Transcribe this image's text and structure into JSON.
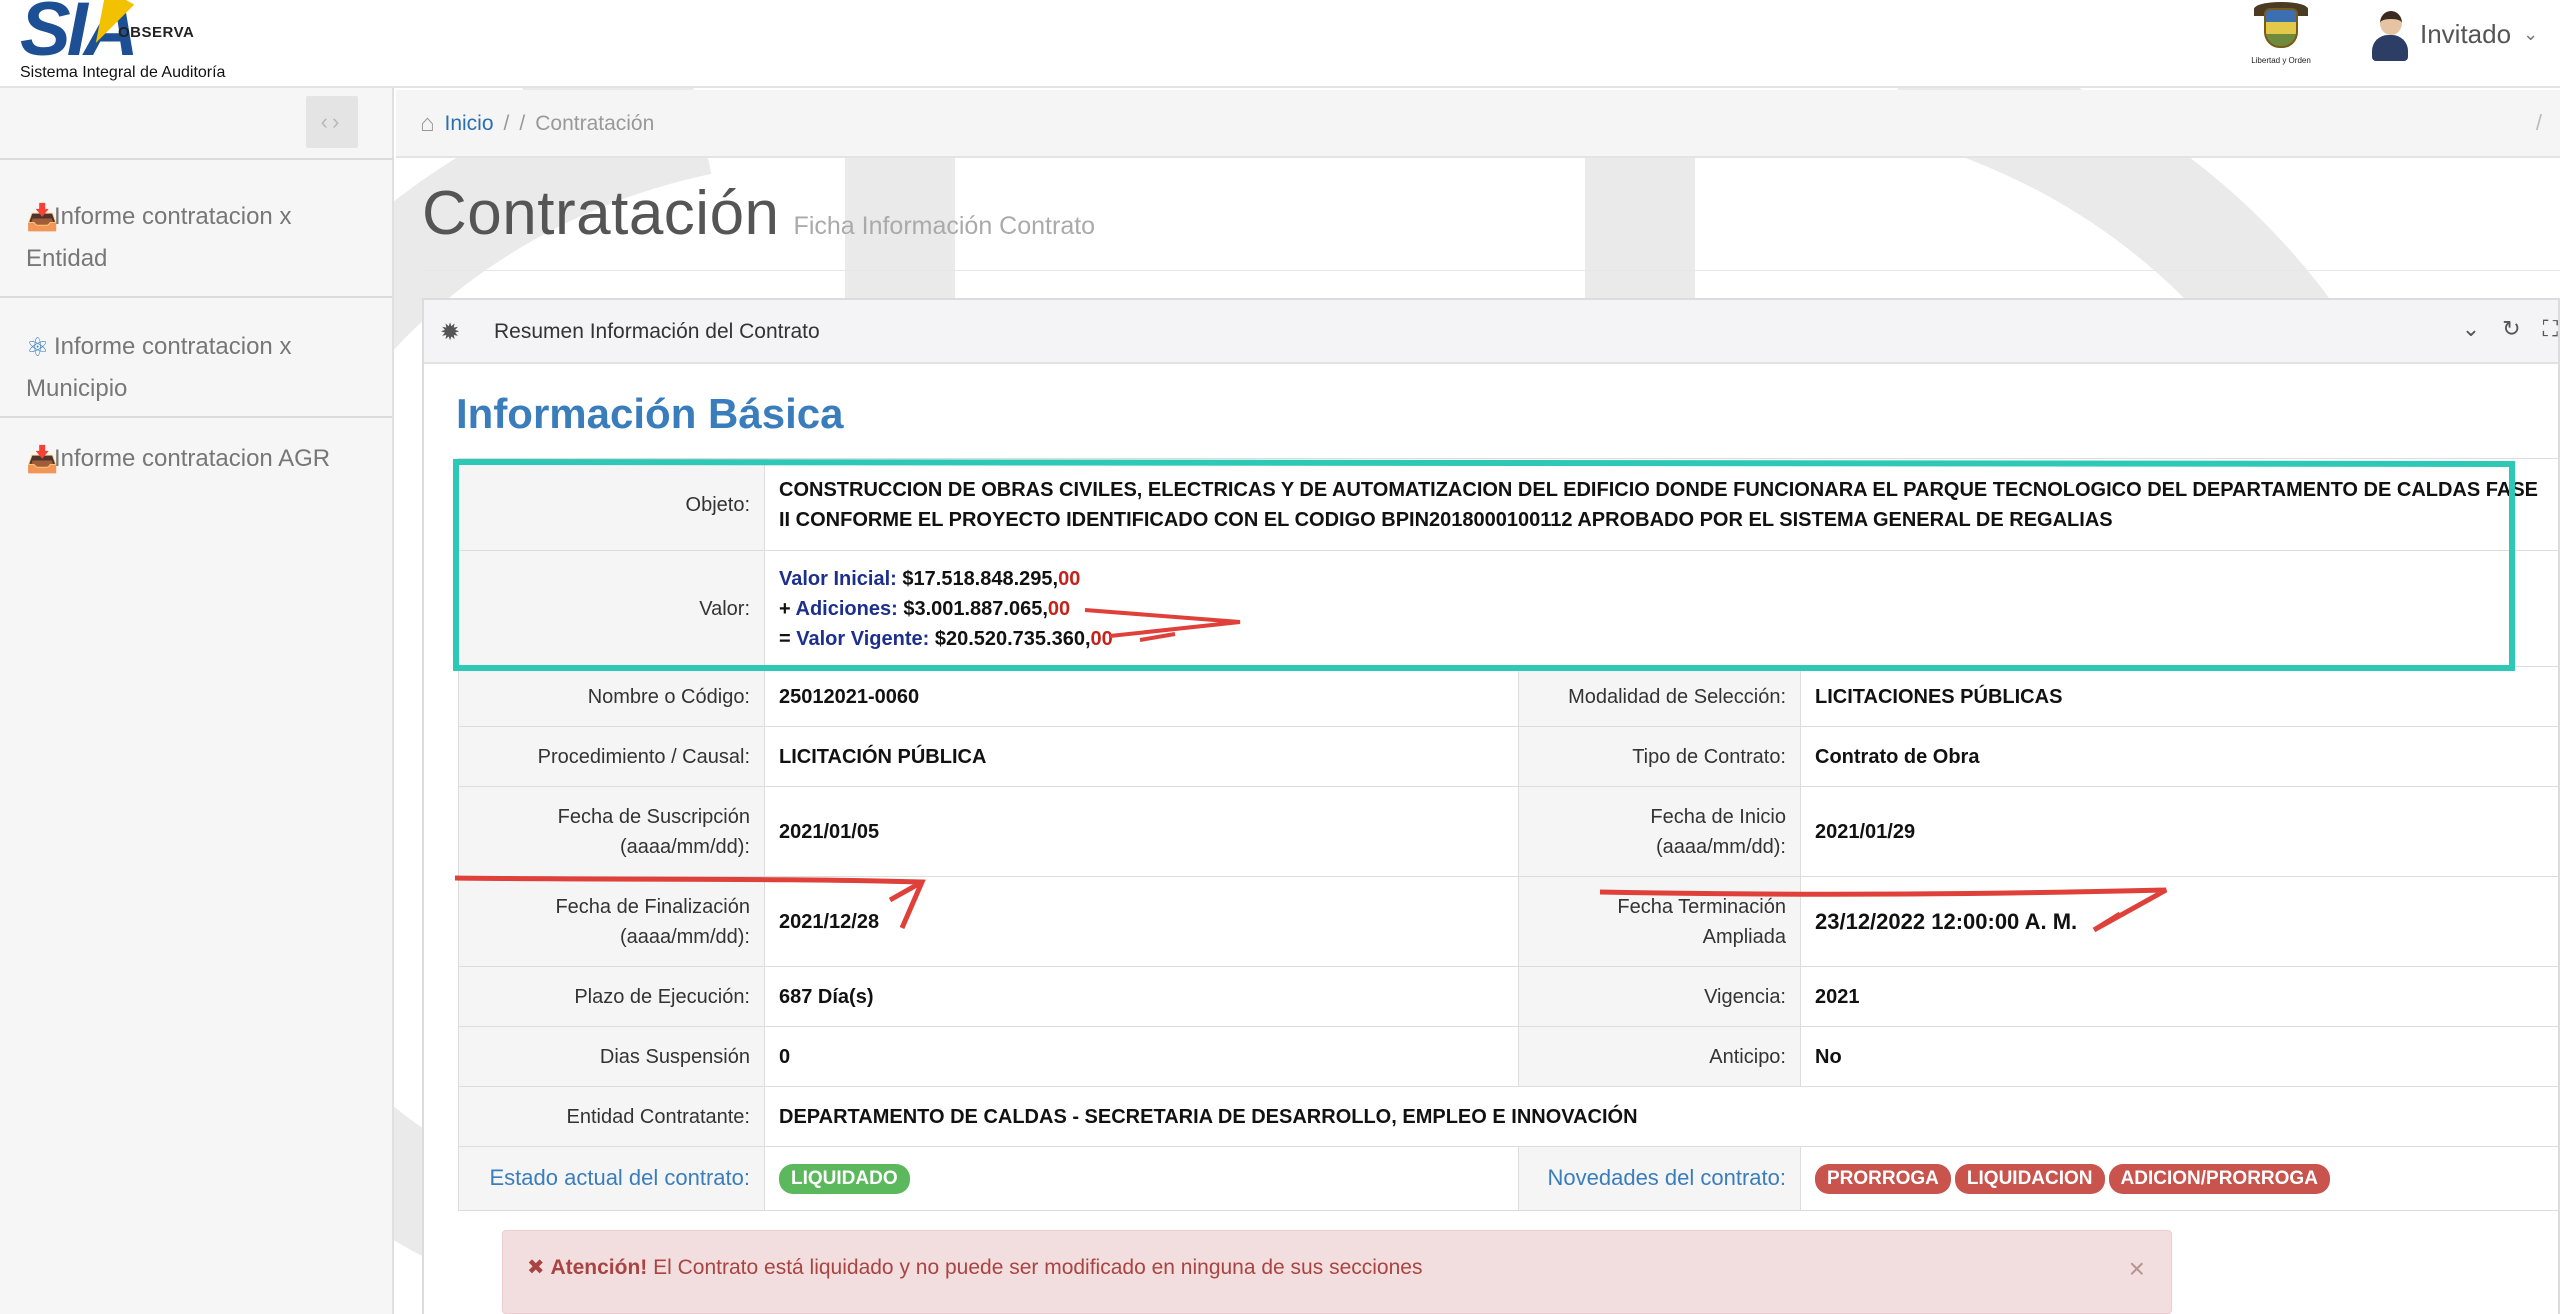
{
  "header": {
    "logo_text": "SIA",
    "logo_badge": "OBSERVA",
    "logo_subtitle": "Sistema Integral de Auditoría",
    "emblem_caption": "Libertad y Orden",
    "user_name": "Invitado"
  },
  "sidebar": {
    "items": [
      {
        "label": "Informe contratacion x Entidad",
        "icon": "inbox-icon"
      },
      {
        "label": "Informe contratacion x Municipio",
        "icon": "atom-icon"
      },
      {
        "label": "Informe contratacion AGR",
        "icon": "inbox-icon"
      }
    ]
  },
  "breadcrumb": {
    "home": "Inicio",
    "separator": "/",
    "current": "Contratación"
  },
  "page": {
    "title": "Contratación",
    "subtitle": "Ficha Información Contrato"
  },
  "panel": {
    "title": "Resumen Información del Contrato"
  },
  "section": {
    "title": "Información Básica"
  },
  "contract": {
    "objeto_label": "Objeto:",
    "objeto": "CONSTRUCCION DE OBRAS CIVILES, ELECTRICAS Y DE AUTOMATIZACION DEL EDIFICIO DONDE FUNCIONARA EL PARQUE TECNOLOGICO DEL DEPARTAMENTO DE CALDAS FASE II CONFORME EL PROYECTO IDENTIFICADO CON EL CODIGO BPIN2018000100112 APROBADO POR EL SISTEMA GENERAL DE REGALIAS",
    "valor_label": "Valor:",
    "valor_inicial_label": "Valor Inicial:",
    "valor_inicial": "$17.518.848.295,",
    "valor_inicial_cents": "00",
    "adiciones_prefix": "+",
    "adiciones_label": "Adiciones:",
    "adiciones": "$3.001.887.065,",
    "adiciones_cents": "00",
    "vigente_prefix": "=",
    "vigente_label": "Valor Vigente:",
    "vigente": "$20.520.735.360,",
    "vigente_cents": "00",
    "rows": [
      {
        "l1": "Nombre o Código:",
        "v1": "25012021-0060",
        "l2": "Modalidad de Selección:",
        "v2": "LICITACIONES PÚBLICAS"
      },
      {
        "l1": "Procedimiento / Causal:",
        "v1": "LICITACIÓN PÚBLICA",
        "l2": "Tipo de Contrato:",
        "v2": "Contrato de Obra"
      },
      {
        "l1": "Fecha de Suscripción (aaaa/mm/dd):",
        "v1": "2021/01/05",
        "l2": "Fecha de Inicio (aaaa/mm/dd):",
        "v2": "2021/01/29"
      },
      {
        "l1": "Fecha de Finalización (aaaa/mm/dd):",
        "v1": "2021/12/28",
        "l2": "Fecha Terminación Ampliada",
        "v2": "23/12/2022 12:00:00 A. M."
      },
      {
        "l1": "Plazo de Ejecución:",
        "v1": "687 Día(s)",
        "l2": "Vigencia:",
        "v2": "2021"
      },
      {
        "l1": "Dias Suspensión",
        "v1": "0",
        "l2": "Anticipo:",
        "v2": "No"
      }
    ],
    "entidad_label": "Entidad Contratante:",
    "entidad": "DEPARTAMENTO DE CALDAS - SECRETARIA DE DESARROLLO, EMPLEO E INNOVACIÓN",
    "estado_label": "Estado actual del contrato:",
    "estado": "LIQUIDADO",
    "novedades_label": "Novedades del contrato:",
    "novedades": [
      "PRORROGA",
      "LIQUIDACION",
      "ADICION/PRORROGA"
    ]
  },
  "alert": {
    "title": "Atención!",
    "message": "El Contrato está liquidado y no puede ser modificado en ninguna de sus secciones"
  },
  "colors": {
    "accent_blue": "#3a7dbd",
    "highlight_teal": "#2ec9b6",
    "annotation_red": "#e0403a",
    "badge_green": "#5cb85c",
    "badge_red": "#c9534d"
  }
}
